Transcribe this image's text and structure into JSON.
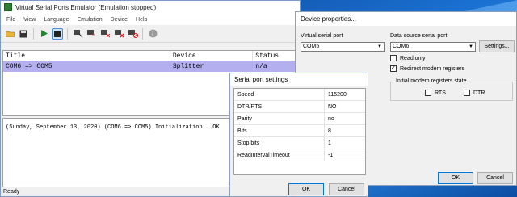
{
  "main_window": {
    "title": "Virtual Serial Ports Emulator (Emulation stopped)",
    "menu": [
      "File",
      "View",
      "Language",
      "Emulation",
      "Device",
      "Help"
    ],
    "toolbar": [
      "open-icon",
      "save-icon",
      "play-icon",
      "stop-icon",
      "device-add-icon",
      "device-star-icon",
      "device-remove-icon",
      "device-delete-icon",
      "device-disable-icon",
      "info-icon"
    ],
    "columns": [
      "Title",
      "Device",
      "Status"
    ],
    "rows": [
      {
        "title": "COM6 => COM5",
        "device": "Splitter",
        "status": "n/a"
      }
    ],
    "log": "(Sunday, September 13, 2020) (COM6 => COM5) Initialization...OK",
    "status": "Ready"
  },
  "device_properties": {
    "title": "Device properties...",
    "virtual_label": "Virtual serial port",
    "virtual_value": "COM5",
    "source_label": "Data source serial port",
    "source_value": "COM6",
    "settings_button": "Settings...",
    "read_only": "Read only",
    "redirect": "Redirect modem registers",
    "group_label": "Initial modem registers state",
    "rts": "RTS",
    "dtr": "DTR",
    "ok": "OK",
    "cancel": "Cancel"
  },
  "serial_settings": {
    "title": "Serial port settings",
    "rows": [
      {
        "key": "Speed",
        "value": "115200"
      },
      {
        "key": "DTR/RTS",
        "value": "NO"
      },
      {
        "key": "Parity",
        "value": "no"
      },
      {
        "key": "Bits",
        "value": "8"
      },
      {
        "key": "Stop bits",
        "value": "1"
      },
      {
        "key": "ReadIntervalTimeout",
        "value": "-1"
      }
    ],
    "ok": "OK",
    "cancel": "Cancel"
  }
}
